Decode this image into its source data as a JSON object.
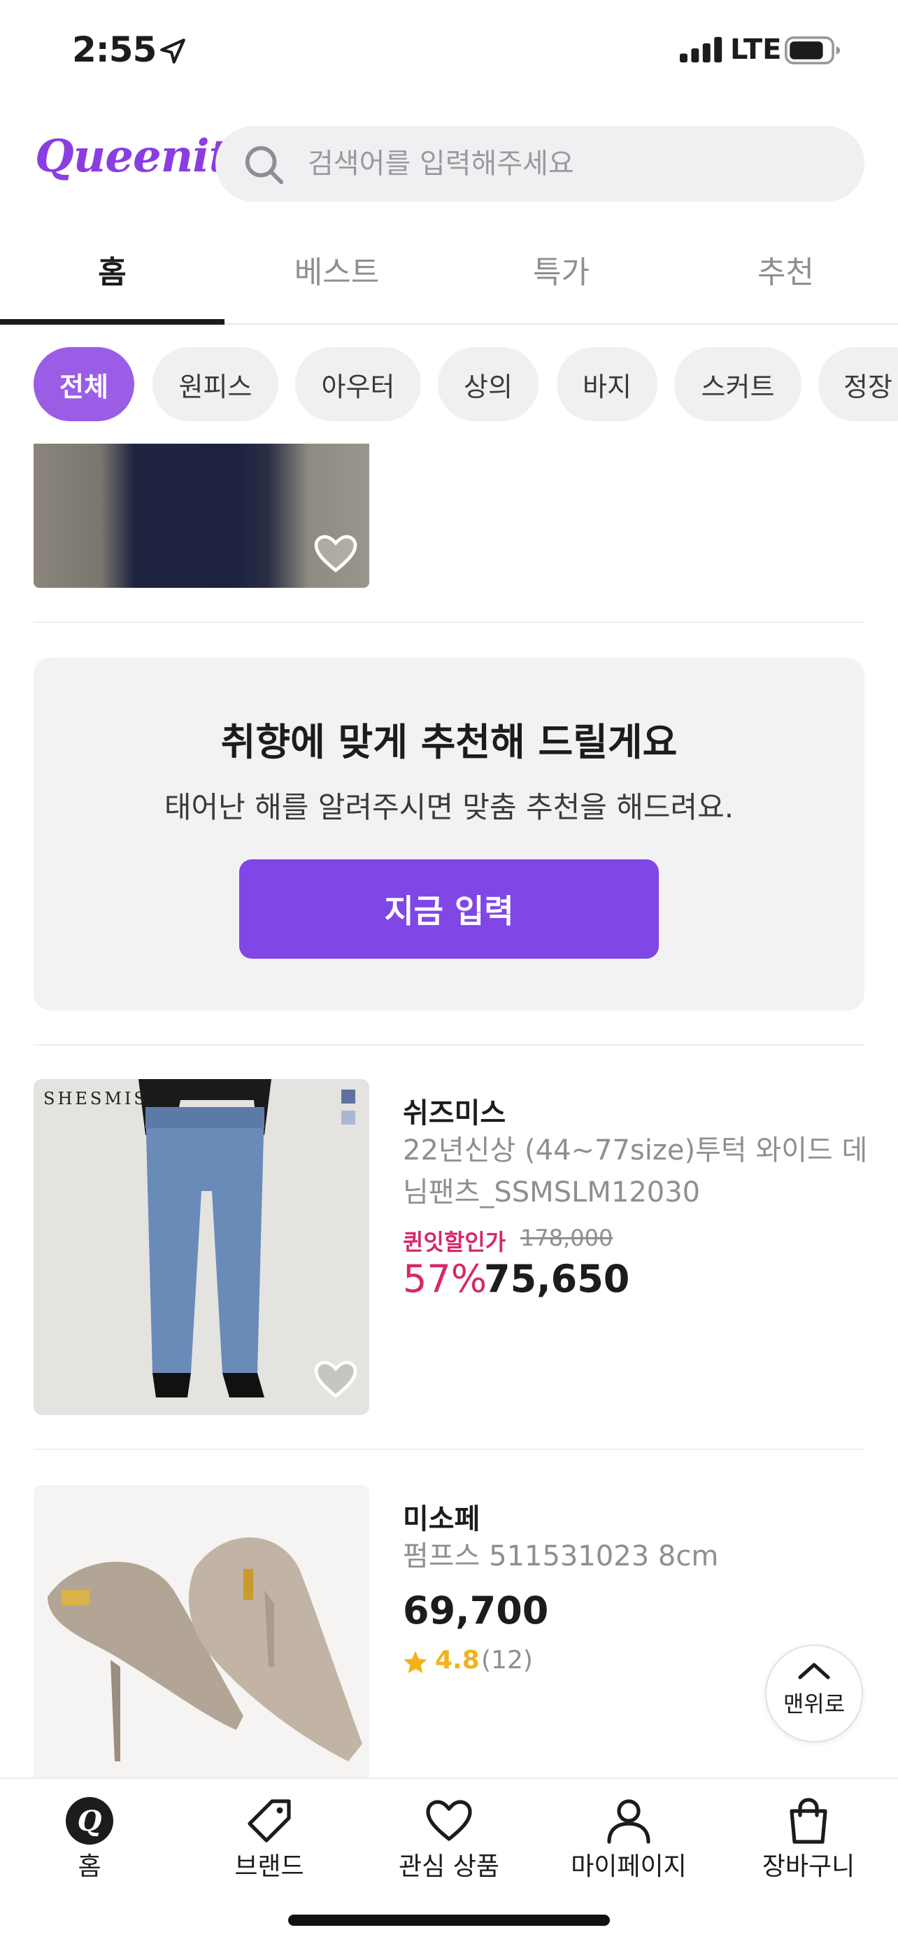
{
  "status_bar": {
    "time": "2:55",
    "network": "LTE"
  },
  "header": {
    "logo": "Queenit",
    "search_placeholder": "검색어를 입력해주세요"
  },
  "tabs": [
    {
      "label": "홈",
      "active": true
    },
    {
      "label": "베스트",
      "active": false
    },
    {
      "label": "특가",
      "active": false
    },
    {
      "label": "추천",
      "active": false
    }
  ],
  "categories": [
    {
      "label": "전체",
      "active": true
    },
    {
      "label": "원피스"
    },
    {
      "label": "아우터"
    },
    {
      "label": "상의"
    },
    {
      "label": "바지"
    },
    {
      "label": "스커트"
    },
    {
      "label": "정장"
    }
  ],
  "recommend": {
    "title": "취향에 맞게 추천해 드릴게요",
    "subtitle": "태어난 해를 알려주시면 맞춤 추천을 해드려요.",
    "button": "지금 입력"
  },
  "products": [
    {
      "image_text": "SHESMIS",
      "brand": "쉬즈미스",
      "name_line1": "22년신상 (44~77size)투턱 와이드 데",
      "name_line2": "님팬츠_SSMSLM12030",
      "discount_label": "퀸잇할인가",
      "original_price": "178,000",
      "discount": "57%",
      "price": "75,650"
    },
    {
      "brand": "미소페",
      "name": "펌프스 511531023 8cm",
      "price": "69,700",
      "rating": "4.8",
      "review_count": "(12)"
    }
  ],
  "scroll_top_label": "맨위로",
  "bottom_nav": [
    {
      "label": "홈",
      "icon": "home-q-icon"
    },
    {
      "label": "브랜드",
      "icon": "tag-icon"
    },
    {
      "label": "관심 상품",
      "icon": "heart-icon"
    },
    {
      "label": "마이페이지",
      "icon": "person-icon"
    },
    {
      "label": "장바구니",
      "icon": "shopping-bag-icon"
    }
  ],
  "colors": {
    "accent": "#8046e6",
    "chip_active": "#9b5de5",
    "discount": "#d6286a",
    "rating": "#f2b21e"
  }
}
